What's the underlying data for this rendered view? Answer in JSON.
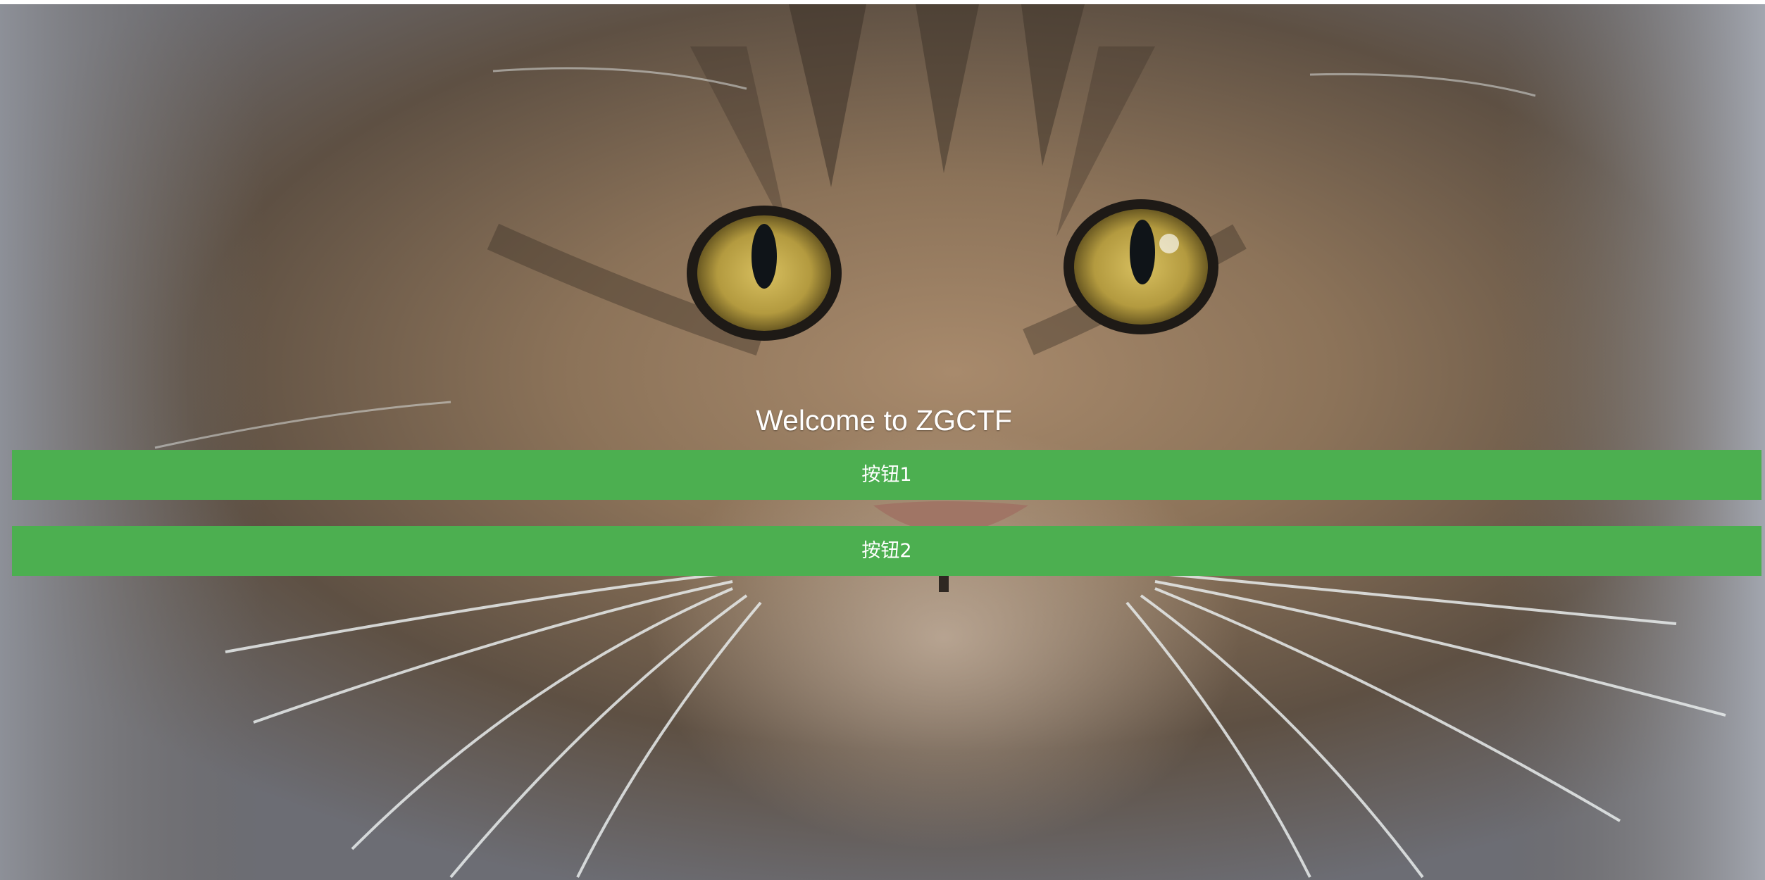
{
  "page": {
    "heading": "Welcome to ZGCTF",
    "background_image": "tabby-cat-face-closeup"
  },
  "buttons": [
    {
      "label": "按钮1"
    },
    {
      "label": "按钮2"
    }
  ],
  "colors": {
    "button_background": "#4caf50",
    "button_text": "#ffffff",
    "heading_text": "#ffffff"
  }
}
